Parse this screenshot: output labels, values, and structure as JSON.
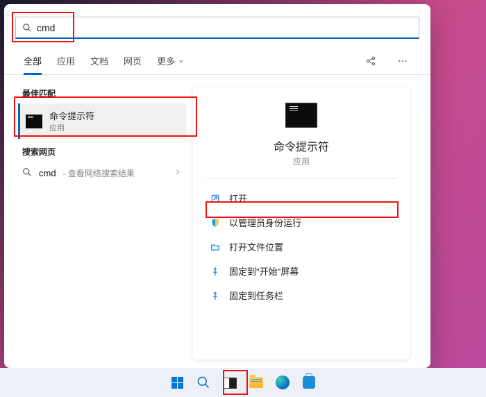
{
  "search": {
    "value": "cmd"
  },
  "tabs": {
    "all": "全部",
    "apps": "应用",
    "documents": "文档",
    "web": "网页",
    "more": "更多"
  },
  "sections": {
    "best_match": "最佳匹配",
    "search_web": "搜索网页"
  },
  "best_match": {
    "title": "命令提示符",
    "subtitle": "应用"
  },
  "web_result": {
    "term": "cmd",
    "suffix": "查看网络搜索结果"
  },
  "preview": {
    "title": "命令提示符",
    "subtitle": "应用"
  },
  "actions": {
    "open": "打开",
    "run_admin": "以管理员身份运行",
    "open_location": "打开文件位置",
    "pin_start": "固定到\"开始\"屏幕",
    "pin_taskbar": "固定到任务栏"
  }
}
